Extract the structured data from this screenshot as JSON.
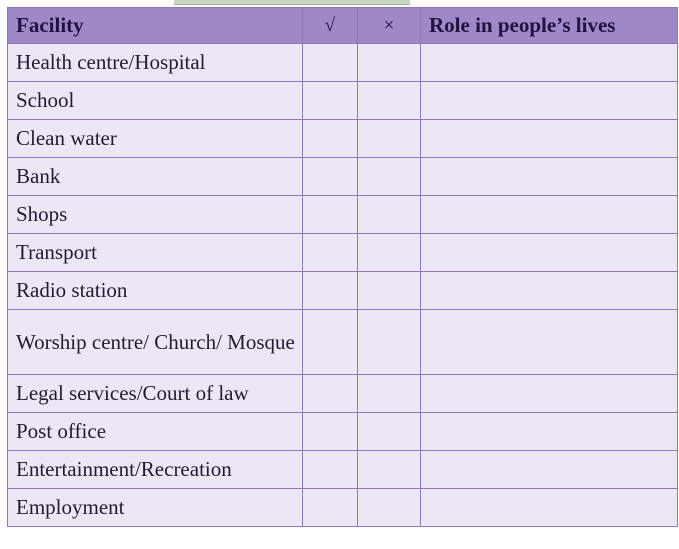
{
  "table": {
    "headers": {
      "facility": "Facility",
      "tick": "√",
      "cross": "×",
      "role": "Role in people’s lives"
    },
    "rows": [
      {
        "facility": "Health centre/Hospital",
        "tick": "",
        "cross": "",
        "role": ""
      },
      {
        "facility": "School",
        "tick": "",
        "cross": "",
        "role": ""
      },
      {
        "facility": "Clean water",
        "tick": "",
        "cross": "",
        "role": ""
      },
      {
        "facility": "Bank",
        "tick": "",
        "cross": "",
        "role": ""
      },
      {
        "facility": "Shops",
        "tick": "",
        "cross": "",
        "role": ""
      },
      {
        "facility": "Transport",
        "tick": "",
        "cross": "",
        "role": ""
      },
      {
        "facility": "Radio station",
        "tick": "",
        "cross": "",
        "role": ""
      },
      {
        "facility": "Worship centre/ Church/ Mosque",
        "tick": "",
        "cross": "",
        "role": ""
      },
      {
        "facility": "Legal services/Court of law",
        "tick": "",
        "cross": "",
        "role": ""
      },
      {
        "facility": "Post office",
        "tick": "",
        "cross": "",
        "role": ""
      },
      {
        "facility": "Entertainment/Recreation",
        "tick": "",
        "cross": "",
        "role": ""
      },
      {
        "facility": "Employment",
        "tick": "",
        "cross": "",
        "role": ""
      }
    ]
  }
}
